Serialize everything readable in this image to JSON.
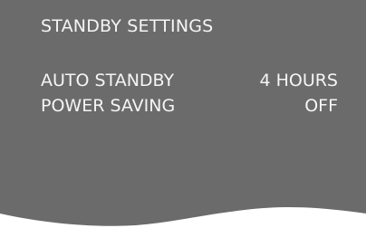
{
  "theme": {
    "panel_color": "#6b6b6b",
    "text_color": "#f5f5f5",
    "background_color": "#ffffff"
  },
  "menu": {
    "title": "STANDBY SETTINGS",
    "items": [
      {
        "label": "AUTO STANDBY",
        "value": "4 HOURS"
      },
      {
        "label": "POWER SAVING",
        "value": "OFF"
      }
    ]
  }
}
